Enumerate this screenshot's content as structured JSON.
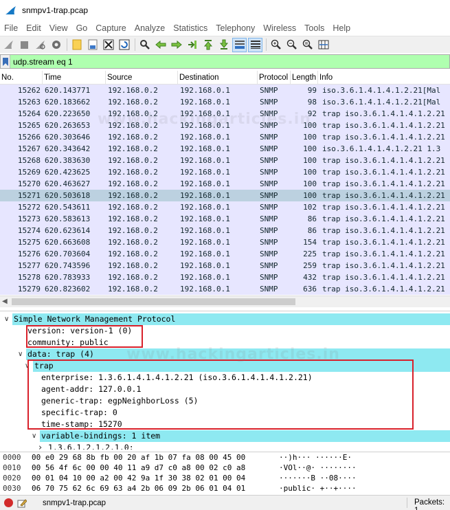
{
  "window": {
    "title": "snmpv1-trap.pcap"
  },
  "menu": [
    "File",
    "Edit",
    "View",
    "Go",
    "Capture",
    "Analyze",
    "Statistics",
    "Telephony",
    "Wireless",
    "Tools",
    "Help"
  ],
  "toolbar_icons": [
    "shark-fin-start-icon",
    "stop-capture-icon",
    "restart-capture-icon",
    "capture-options-icon",
    "open-file-icon",
    "save-file-icon",
    "close-file-icon",
    "reload-file-icon",
    "find-packet-icon",
    "go-back-icon",
    "go-forward-icon",
    "go-to-packet-icon",
    "go-first-icon",
    "go-last-icon",
    "autoscroll-icon",
    "colorize-icon",
    "zoom-in-icon",
    "zoom-out-icon",
    "normal-size-icon",
    "resize-columns-icon"
  ],
  "filter": {
    "value": "udp.stream eq 1"
  },
  "packet_list": {
    "columns": [
      "No.",
      "Time",
      "Source",
      "Destination",
      "Protocol",
      "Length",
      "Info"
    ],
    "rows": [
      [
        "15262",
        "620.143771",
        "192.168.0.2",
        "192.168.0.1",
        "SNMP",
        "99",
        "iso.3.6.1.4.1.4.1.2.21[Mal"
      ],
      [
        "15263",
        "620.183662",
        "192.168.0.2",
        "192.168.0.1",
        "SNMP",
        "98",
        "iso.3.6.1.4.1.4.1.2.21[Mal"
      ],
      [
        "15264",
        "620.223650",
        "192.168.0.2",
        "192.168.0.1",
        "SNMP",
        "92",
        "trap iso.3.6.1.4.1.4.1.2.21"
      ],
      [
        "15265",
        "620.263653",
        "192.168.0.2",
        "192.168.0.1",
        "SNMP",
        "100",
        "trap iso.3.6.1.4.1.4.1.2.21"
      ],
      [
        "15266",
        "620.303646",
        "192.168.0.2",
        "192.168.0.1",
        "SNMP",
        "100",
        "trap iso.3.6.1.4.1.4.1.2.21"
      ],
      [
        "15267",
        "620.343642",
        "192.168.0.2",
        "192.168.0.1",
        "SNMP",
        "100",
        "iso.3.6.1.4.1.4.1.2.21 1.3"
      ],
      [
        "15268",
        "620.383630",
        "192.168.0.2",
        "192.168.0.1",
        "SNMP",
        "100",
        "trap iso.3.6.1.4.1.4.1.2.21"
      ],
      [
        "15269",
        "620.423625",
        "192.168.0.2",
        "192.168.0.1",
        "SNMP",
        "100",
        "trap iso.3.6.1.4.1.4.1.2.21"
      ],
      [
        "15270",
        "620.463627",
        "192.168.0.2",
        "192.168.0.1",
        "SNMP",
        "100",
        "trap iso.3.6.1.4.1.4.1.2.21"
      ],
      [
        "15271",
        "620.503618",
        "192.168.0.2",
        "192.168.0.1",
        "SNMP",
        "100",
        "trap iso.3.6.1.4.1.4.1.2.21"
      ],
      [
        "15272",
        "620.543611",
        "192.168.0.2",
        "192.168.0.1",
        "SNMP",
        "102",
        "trap iso.3.6.1.4.1.4.1.2.21"
      ],
      [
        "15273",
        "620.583613",
        "192.168.0.2",
        "192.168.0.1",
        "SNMP",
        "86",
        "trap iso.3.6.1.4.1.4.1.2.21"
      ],
      [
        "15274",
        "620.623614",
        "192.168.0.2",
        "192.168.0.1",
        "SNMP",
        "86",
        "trap iso.3.6.1.4.1.4.1.2.21"
      ],
      [
        "15275",
        "620.663608",
        "192.168.0.2",
        "192.168.0.1",
        "SNMP",
        "154",
        "trap iso.3.6.1.4.1.4.1.2.21"
      ],
      [
        "15276",
        "620.703604",
        "192.168.0.2",
        "192.168.0.1",
        "SNMP",
        "225",
        "trap iso.3.6.1.4.1.4.1.2.21"
      ],
      [
        "15277",
        "620.743596",
        "192.168.0.2",
        "192.168.0.1",
        "SNMP",
        "259",
        "trap iso.3.6.1.4.1.4.1.2.21"
      ],
      [
        "15278",
        "620.783933",
        "192.168.0.2",
        "192.168.0.1",
        "SNMP",
        "432",
        "trap iso.3.6.1.4.1.4.1.2.21"
      ],
      [
        "15279",
        "620.823602",
        "192.168.0.2",
        "192.168.0.1",
        "SNMP",
        "636",
        "trap iso.3.6.1.4.1.4.1.2.21"
      ]
    ],
    "selected_no": "15271",
    "row_color": "#e7e6ff",
    "selected_color": "#bcd1e0"
  },
  "watermark": "www.hackingarticles.in",
  "details": [
    {
      "text": "Simple Network Management Protocol",
      "expander": "down",
      "highlight": true
    },
    {
      "text": "version: version-1 (0)",
      "expander": null,
      "highlight": false
    },
    {
      "text": "community: public",
      "expander": null,
      "highlight": false
    },
    {
      "text": "data: trap (4)",
      "expander": "down",
      "highlight": true
    },
    {
      "text": "trap",
      "expander": "down",
      "highlight": true
    },
    {
      "text": "enterprise: 1.3.6.1.4.1.4.1.2.21 (iso.3.6.1.4.1.4.1.2.21)",
      "expander": null,
      "highlight": false
    },
    {
      "text": "agent-addr: 127.0.0.1",
      "expander": null,
      "highlight": false
    },
    {
      "text": "generic-trap: egpNeighborLoss (5)",
      "expander": null,
      "highlight": false
    },
    {
      "text": "specific-trap: 0",
      "expander": null,
      "highlight": false
    },
    {
      "text": "time-stamp: 15270",
      "expander": null,
      "highlight": false
    },
    {
      "text": "variable-bindings: 1 item",
      "expander": "down",
      "highlight": true
    },
    {
      "text": "1.3.6.1.2.1.2.1.0:",
      "expander": "right",
      "highlight": false
    }
  ],
  "bytes": [
    {
      "offset": "0000",
      "hex": "00 e0 29 68 8b fb 00 20  af 1b 07 fa 08 00 45 00",
      "ascii": "··)h··· ······E·"
    },
    {
      "offset": "0010",
      "hex": "00 56 4f 6c 00 00 40 11  a9 d7 c0 a8 00 02 c0 a8",
      "ascii": "·VOl··@· ········"
    },
    {
      "offset": "0020",
      "hex": "00 01 04 10 00 a2 00 42  9a 1f 30 38 02 01 00 04",
      "ascii": "·······B ··08····"
    },
    {
      "offset": "0030",
      "hex": "06 70 75 62 6c 69 63 a4  2b 06 09 2b 06 01 04 01",
      "ascii": "·public· +··+····"
    }
  ],
  "status": {
    "file": "snmpv1-trap.pcap",
    "packets": "Packets: 1"
  },
  "colors": {
    "filter_ok": "#afffaf",
    "detail_highlight": "#8ee9f1",
    "annotation_box": "#d8202a"
  }
}
